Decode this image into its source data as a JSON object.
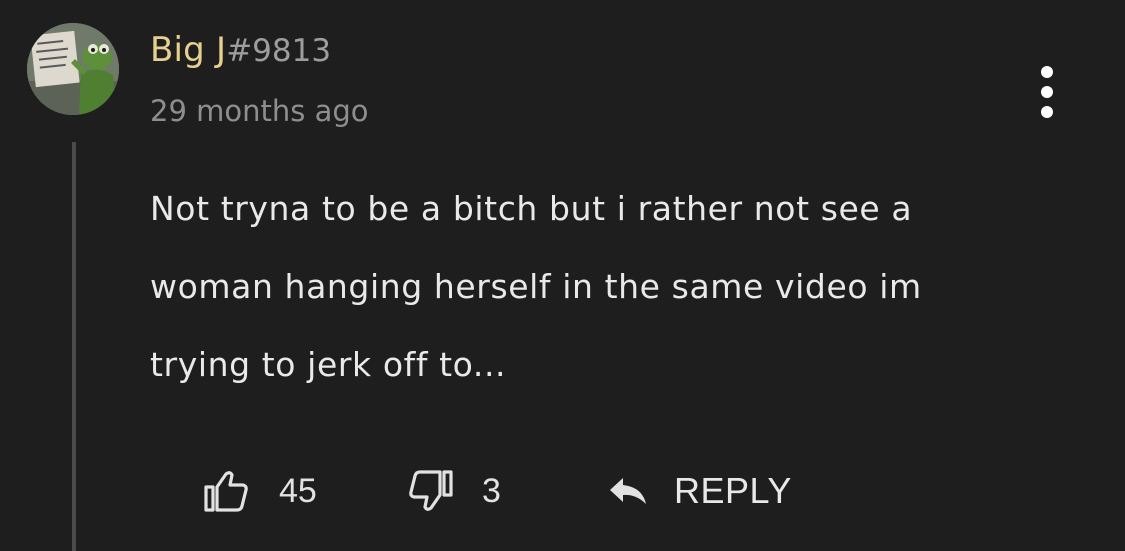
{
  "comment": {
    "author": {
      "name": "Big J",
      "tag": "#9813"
    },
    "timestamp": "29 months ago",
    "body": "Not tryna to be a bitch but i rather not see a woman hanging herself in the same video im trying to jerk off to...",
    "likes": "45",
    "dislikes": "3",
    "reply_label": "REPLY",
    "icons": {
      "like": "thumbs-up-icon",
      "dislike": "thumbs-down-icon",
      "reply": "reply-arrow-icon",
      "more": "more-vertical-icon"
    },
    "colors": {
      "background": "#1f1e1f",
      "username": "#e6cf8f",
      "text": "#e9e9e9",
      "muted": "#8e8e8e"
    }
  }
}
